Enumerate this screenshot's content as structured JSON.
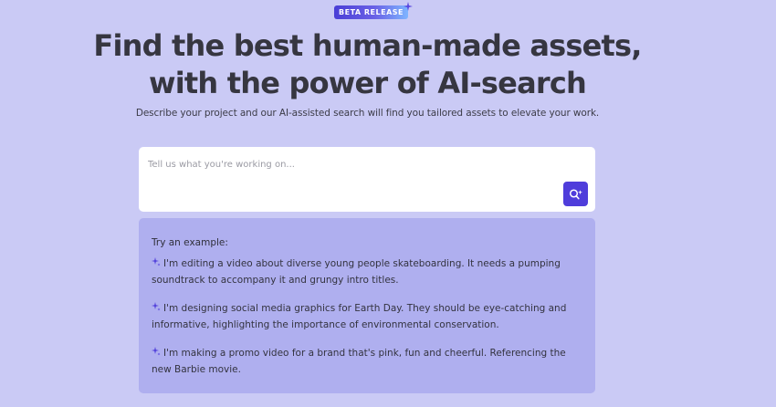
{
  "badge": {
    "label": "BETA RELEASE",
    "gradient_start": "#4a3ed6",
    "gradient_end": "#7eb5ff",
    "sparkle_icon": "sparkle-icon"
  },
  "hero": {
    "title_line1": "Find the best human-made assets,",
    "title_line2": "with the power of AI-search",
    "subtitle": "Describe your project and our AI-assisted search will find you tailored assets to elevate your work."
  },
  "search": {
    "placeholder": "Tell us what you're working on...",
    "value": "",
    "button_icon": "ai-search-icon",
    "button_color": "#4f3ddb"
  },
  "examples": {
    "heading": "Try an example:",
    "item_icon": "sparkle-icon",
    "items": [
      {
        "text": "I'm editing a video about diverse young people skateboarding. It needs a pumping soundtrack to accompany it and grungy intro titles."
      },
      {
        "text": "I'm designing social media graphics for Earth Day. They should be eye-catching and informative, highlighting the importance of environmental conservation."
      },
      {
        "text": "I'm making a promo video for a brand that's pink, fun and cheerful. Referencing the new Barbie movie."
      }
    ]
  },
  "colors": {
    "page_background": "#cacaf5",
    "panel_background": "#afafef",
    "accent": "#4f3ddb"
  }
}
